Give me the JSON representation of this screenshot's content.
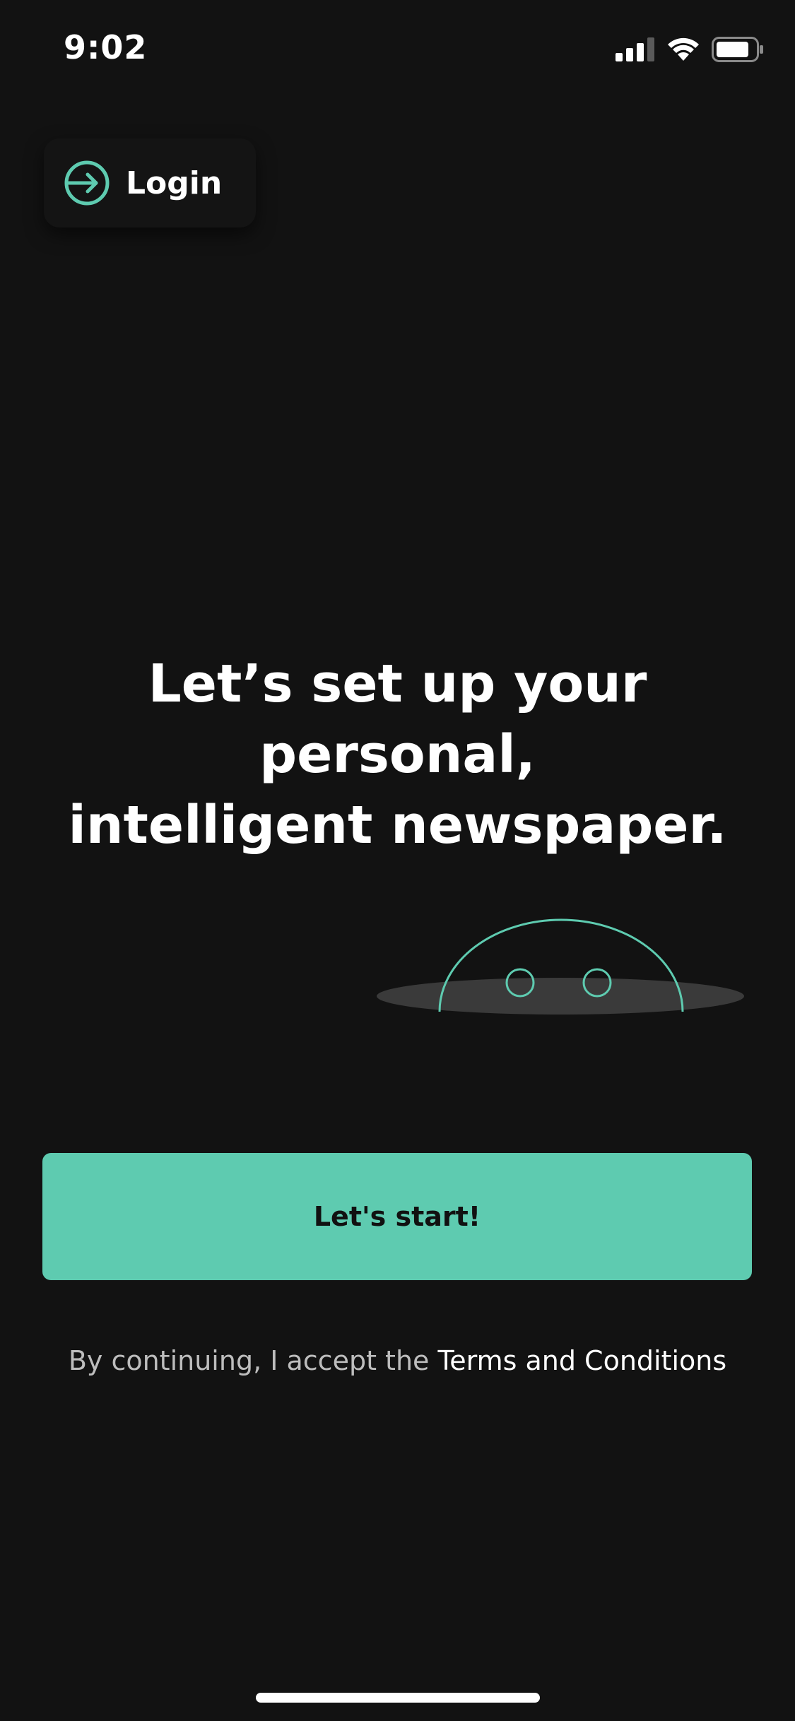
{
  "status_bar": {
    "time": "9:02",
    "icons": [
      "cellular-signal-icon",
      "wifi-icon",
      "battery-icon"
    ]
  },
  "login": {
    "label": "Login",
    "icon": "login-arrow-icon"
  },
  "headline": {
    "line1": "Let’s set up your personal,",
    "line2": "intelligent newspaper."
  },
  "illustration": {
    "icon": "peeking-robot-illustration"
  },
  "start_button": {
    "label": "Let's start!"
  },
  "terms": {
    "prefix": "By continuing, I accept the ",
    "link": "Terms and Conditions"
  },
  "colors": {
    "background": "#121212",
    "accent": "#5ecbb0",
    "text_primary": "#ffffff",
    "text_secondary": "#bdbdbd"
  }
}
